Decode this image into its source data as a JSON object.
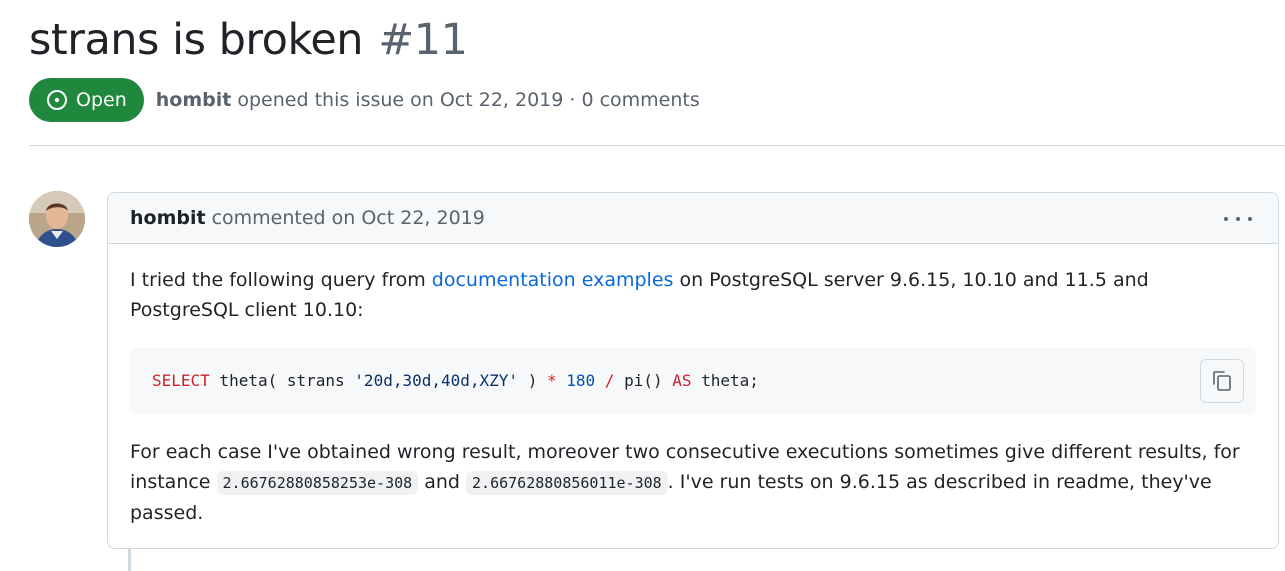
{
  "issue": {
    "title": "strans is broken",
    "number": "#11",
    "state": "Open",
    "author": "hombit",
    "meta_action": "opened this issue on Oct 22, 2019 · 0 comments"
  },
  "comment": {
    "author": "hombit",
    "action": "commented on Oct 22, 2019",
    "paragraph1": {
      "before": "I tried the following query from ",
      "link": "documentation examples",
      "after": " on PostgreSQL server 9.6.15, 10.10 and 11.5 and PostgreSQL client 10.10:"
    },
    "code": {
      "t1": "SELECT",
      "t2": " theta( strans ",
      "t3": "'20d,30d,40d,XZY'",
      "t4": " ) ",
      "t5": "*",
      "t6": " ",
      "t7": "180",
      "t8": " ",
      "t9": "/",
      "t10": " pi() ",
      "t11": "AS",
      "t12": " theta;"
    },
    "paragraph2": {
      "before": "For each case I've obtained wrong result, moreover two consecutive executions sometimes give different results, for instance ",
      "code1": "2.66762880858253e-308",
      "mid": " and ",
      "code2": "2.66762880856011e-308",
      "after": ". I've run tests on 9.6.15 as described in readme, they've passed."
    }
  },
  "colors": {
    "open_badge": "#1f883d",
    "link": "#0969da",
    "muted": "#59636e",
    "keyword": "#cf222e",
    "string": "#0a3069",
    "number": "#0550ae"
  },
  "icons": [
    "issue-opened-icon",
    "kebab-horizontal-icon",
    "copy-icon"
  ]
}
